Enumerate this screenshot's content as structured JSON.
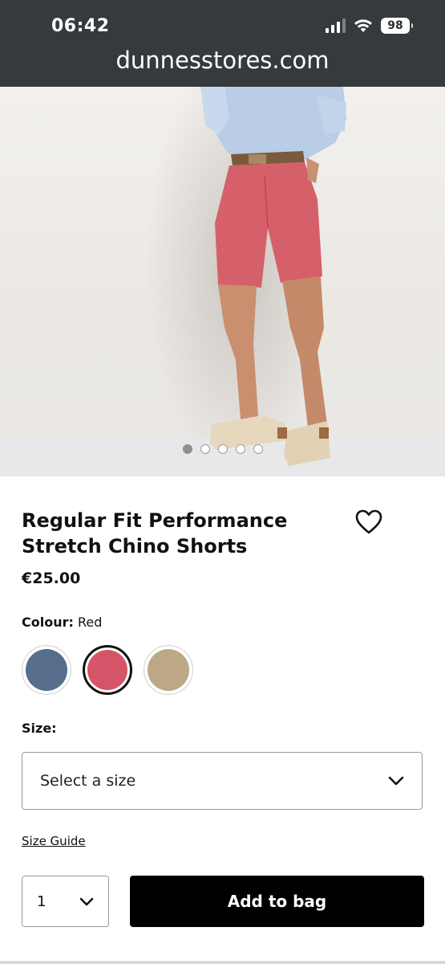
{
  "status_bar": {
    "time": "06:42",
    "battery": "98"
  },
  "browser": {
    "url": "dunnesstores.com"
  },
  "hero": {
    "carousel_count": 5,
    "active_index": 0
  },
  "product": {
    "title": "Regular Fit Performance Stretch Chino Shorts",
    "price": "€25.00",
    "colour_label": "Colour:",
    "colour_value": "Red",
    "swatches": [
      {
        "name": "blue",
        "color": "#566d8b"
      },
      {
        "name": "red",
        "color": "#d65468",
        "selected": true
      },
      {
        "name": "beige",
        "color": "#bda886"
      }
    ],
    "size_label": "Size:",
    "size_placeholder": "Select a size",
    "size_guide": "Size Guide",
    "quantity": "1",
    "add_button": "Add to bag"
  }
}
